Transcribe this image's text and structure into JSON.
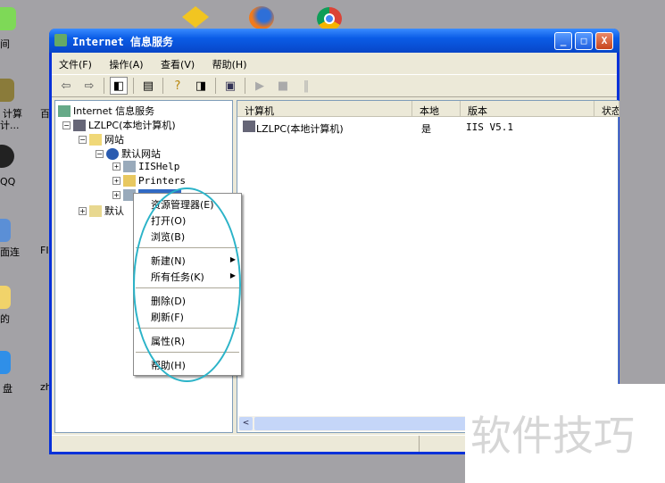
{
  "desktop": {
    "left_labels": [
      "间",
      "计算",
      "计...",
      "QQ",
      "面连",
      "的",
      "盘"
    ],
    "col2_labels": [
      "百",
      "FI",
      "zh"
    ],
    "top_icons": [
      "ie-tester-icon",
      "firefox-icon",
      "chrome-icon"
    ]
  },
  "window": {
    "title": "Internet 信息服务",
    "buttons": {
      "minimize": "_",
      "maximize": "□",
      "close": "X"
    }
  },
  "menu": [
    "文件(F)",
    "操作(A)",
    "查看(V)",
    "帮助(H)"
  ],
  "tree": {
    "root": "Internet 信息服务",
    "computer": "LZLPC(本地计算机)",
    "sites": "网站",
    "default_site": "默认网站",
    "iishelp": "IISHelp",
    "printers": "Printers",
    "default_smtp": "默认"
  },
  "list": {
    "headers": [
      "计算机",
      "本地",
      "版本",
      "状态"
    ],
    "rows": [
      {
        "computer": "LZLPC(本地计算机)",
        "local": "是",
        "version": "IIS V5.1"
      }
    ]
  },
  "context_menu": [
    "资源管理器(E)",
    "打开(O)",
    "浏览(B)",
    "新建(N)",
    "所有任务(K)",
    "删除(D)",
    "刷新(F)",
    "属性(R)",
    "帮助(H)"
  ],
  "watermark": "软件技巧",
  "colors": {
    "titlebar": "#0a5ce6",
    "desktop": "#a3a2a6",
    "highlight_ellipse": "#2bb3c8",
    "selection": "#316ac5"
  }
}
